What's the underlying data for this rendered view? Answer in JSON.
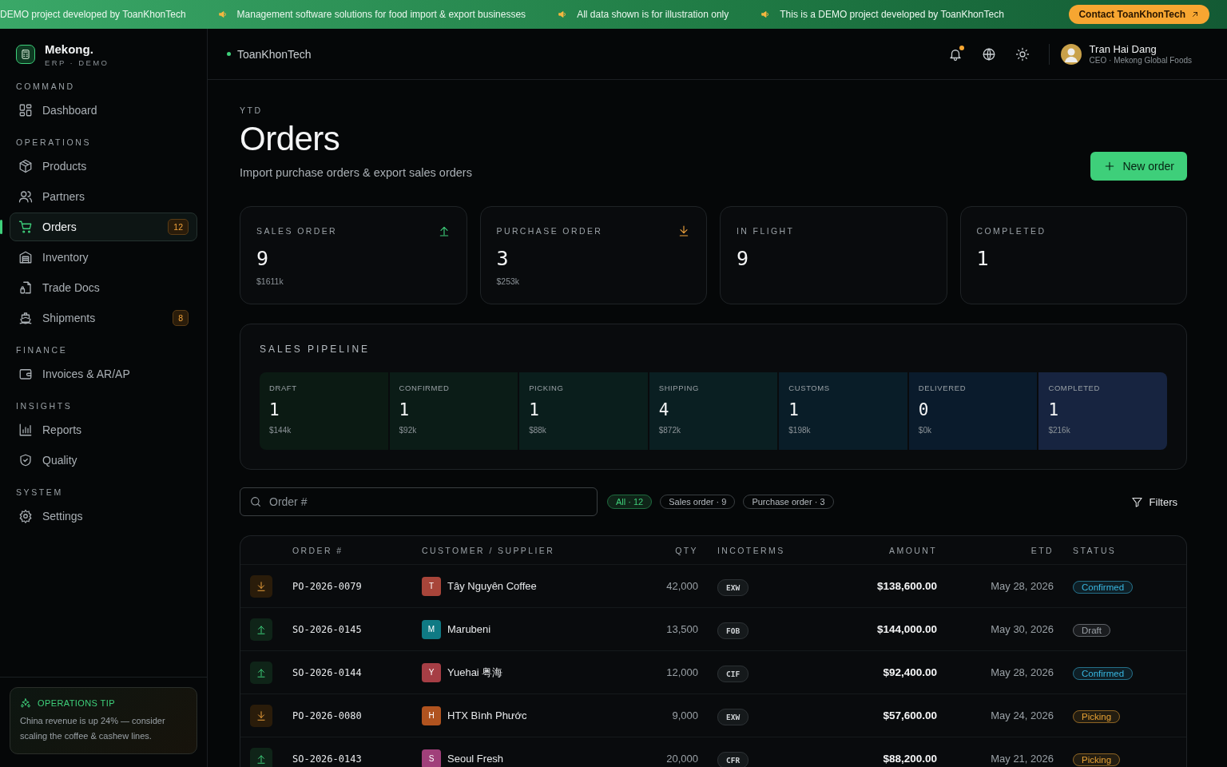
{
  "banner": {
    "messages": [
      "DEMO project developed by ToanKhonTech",
      "Management software solutions for food import & export businesses",
      "All data shown is for illustration only",
      "This is a DEMO project developed by ToanKhonTech"
    ],
    "contact_button": "Contact ToanKhonTech"
  },
  "brand": {
    "name": "Mekong.",
    "subtitle": "ERP · DEMO"
  },
  "sidebar": {
    "sections": [
      {
        "title": "COMMAND",
        "items": [
          {
            "label": "Dashboard",
            "selected": false
          }
        ]
      },
      {
        "title": "OPERATIONS",
        "items": [
          {
            "label": "Products",
            "selected": false
          },
          {
            "label": "Partners",
            "selected": false
          },
          {
            "label": "Orders",
            "selected": true,
            "badge": "12"
          },
          {
            "label": "Inventory",
            "selected": false
          },
          {
            "label": "Trade Docs",
            "selected": false
          },
          {
            "label": "Shipments",
            "selected": false,
            "badge": "8"
          }
        ]
      },
      {
        "title": "FINANCE",
        "items": [
          {
            "label": "Invoices & AR/AP",
            "selected": false
          }
        ]
      },
      {
        "title": "INSIGHTS",
        "items": [
          {
            "label": "Reports",
            "selected": false
          },
          {
            "label": "Quality",
            "selected": false
          }
        ]
      },
      {
        "title": "SYSTEM",
        "items": [
          {
            "label": "Settings",
            "selected": false
          }
        ]
      }
    ],
    "tip": {
      "title": "OPERATIONS TIP",
      "text": "China revenue is up 24% — consider scaling the coffee & cashew lines."
    }
  },
  "header": {
    "workspace": "ToanKhonTech",
    "notification_unread": true,
    "user": {
      "name": "Tran Hai Dang",
      "role": "CEO · Mekong Global Foods"
    }
  },
  "page": {
    "eyebrow": "YTD",
    "title": "Orders",
    "subtitle": "Import purchase orders & export sales orders",
    "new_button": "New order"
  },
  "stats": [
    {
      "label": "SALES ORDER",
      "value": "9",
      "amount": "$1611k",
      "kind": "up"
    },
    {
      "label": "PURCHASE ORDER",
      "value": "3",
      "amount": "$253k",
      "kind": "down"
    },
    {
      "label": "IN FLIGHT",
      "value": "9",
      "kind": "plain"
    },
    {
      "label": "COMPLETED",
      "value": "1",
      "kind": "plain"
    }
  ],
  "pipeline": {
    "title": "SALES PIPELINE",
    "stages": [
      {
        "label": "DRAFT",
        "count": "1",
        "amount": "$144k",
        "color": "#0b1a13"
      },
      {
        "label": "CONFIRMED",
        "count": "1",
        "amount": "$92k",
        "color": "#0b1c17"
      },
      {
        "label": "PICKING",
        "count": "1",
        "amount": "$88k",
        "color": "#0a1e1c"
      },
      {
        "label": "SHIPPING",
        "count": "4",
        "amount": "$872k",
        "color": "#0a1f22"
      },
      {
        "label": "CUSTOMS",
        "count": "1",
        "amount": "$198k",
        "color": "#091d28"
      },
      {
        "label": "DELIVERED",
        "count": "0",
        "amount": "$0k",
        "color": "#0a1b2c"
      },
      {
        "label": "COMPLETED",
        "count": "1",
        "amount": "$216k",
        "color": "#172440"
      }
    ]
  },
  "search": {
    "placeholder": "Order #"
  },
  "filters": [
    {
      "label": "All · 12",
      "selected": true
    },
    {
      "label": "Sales order · 9",
      "selected": false
    },
    {
      "label": "Purchase order · 3",
      "selected": false
    }
  ],
  "filters_button": "Filters",
  "table": {
    "columns": [
      "ORDER #",
      "CUSTOMER / SUPPLIER",
      "QTY",
      "INCOTERMS",
      "AMOUNT",
      "ETD",
      "STATUS"
    ],
    "rows": [
      {
        "kind": "purchase",
        "order": "PO-2026-0079",
        "avatar": {
          "initial": "T",
          "color": "#a8453a"
        },
        "party": "Tây Nguyên Coffee",
        "qty": "42,000",
        "incoterm": "EXW",
        "amount": "$138,600.00",
        "etd": "May 28, 2026",
        "status": {
          "label": "Confirmed",
          "color": "#38b6e0"
        }
      },
      {
        "kind": "sales",
        "order": "SO-2026-0145",
        "avatar": {
          "initial": "M",
          "color": "#0f7a84"
        },
        "party": "Marubeni",
        "qty": "13,500",
        "incoterm": "FOB",
        "amount": "$144,000.00",
        "etd": "May 30, 2026",
        "status": {
          "label": "Draft",
          "color": "#9aa0a6"
        }
      },
      {
        "kind": "sales",
        "order": "SO-2026-0144",
        "avatar": {
          "initial": "Y",
          "color": "#a63e45"
        },
        "party": "Yuehai 粤海",
        "qty": "12,000",
        "incoterm": "CIF",
        "amount": "$92,400.00",
        "etd": "May 28, 2026",
        "status": {
          "label": "Confirmed",
          "color": "#38b6e0"
        }
      },
      {
        "kind": "purchase",
        "order": "PO-2026-0080",
        "avatar": {
          "initial": "H",
          "color": "#b0531f"
        },
        "party": "HTX Bình Phước",
        "qty": "9,000",
        "incoterm": "EXW",
        "amount": "$57,600.00",
        "etd": "May 24, 2026",
        "status": {
          "label": "Picking",
          "color": "#e8a234"
        }
      },
      {
        "kind": "sales",
        "order": "SO-2026-0143",
        "avatar": {
          "initial": "S",
          "color": "#a0407a"
        },
        "party": "Seoul Fresh",
        "qty": "20,000",
        "incoterm": "CFR",
        "amount": "$88,200.00",
        "etd": "May 21, 2026",
        "status": {
          "label": "Picking",
          "color": "#e8a234"
        }
      }
    ]
  }
}
